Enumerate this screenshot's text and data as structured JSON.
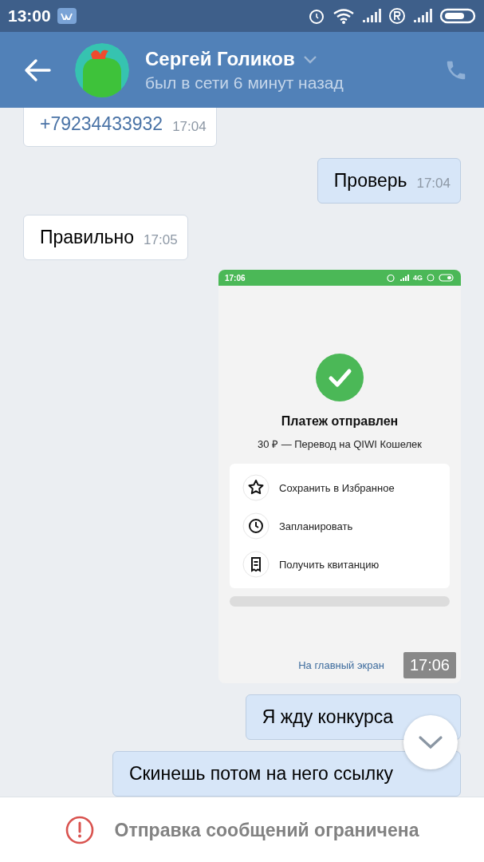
{
  "status_bar": {
    "time": "13:00"
  },
  "header": {
    "name": "Сергей Голиков",
    "status": "был в сети 6 минут назад"
  },
  "messages": [
    {
      "kind": "incoming",
      "text": "+79234433932",
      "time": "17:04",
      "link": true
    },
    {
      "kind": "outgoing",
      "text": "Проверь",
      "time": "17:04"
    },
    {
      "kind": "incoming",
      "text": "Правильно",
      "time": "17:05"
    },
    {
      "kind": "screenshot",
      "time": "17:06",
      "screenshot": {
        "status_time": "17:06",
        "network": "4G",
        "title": "Платеж отправлен",
        "subtitle": "30 ₽ — Перевод на QIWI Кошелек",
        "actions": [
          {
            "kind": "star",
            "label": "Сохранить в Избранное"
          },
          {
            "kind": "clock",
            "label": "Запланировать"
          },
          {
            "kind": "receipt",
            "label": "Получить квитанцию"
          }
        ],
        "link": "На главный экран"
      }
    },
    {
      "kind": "outgoing",
      "text": "Я жду конкурса"
    },
    {
      "kind": "outgoing",
      "text": "Скинешь потом на него ссылку"
    }
  ],
  "footer": {
    "notice": "Отправка сообщений ограничена"
  }
}
